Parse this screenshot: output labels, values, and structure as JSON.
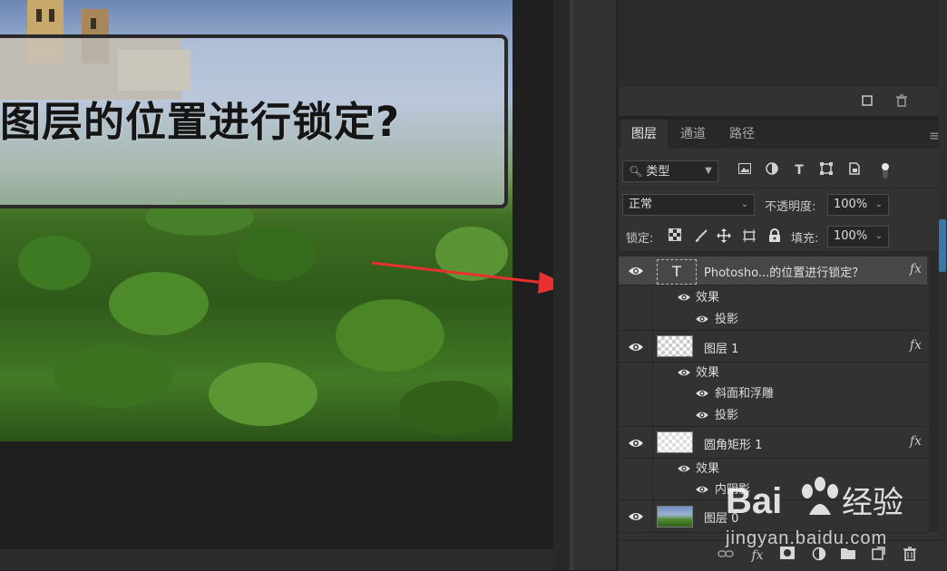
{
  "canvas": {
    "title_text": "图层的位置进行锁定?"
  },
  "panel_tabs": [
    {
      "label": "图层"
    },
    {
      "label": "通道"
    },
    {
      "label": "路径"
    }
  ],
  "filter": {
    "kind_label": "类型",
    "icons": [
      "image-filter-icon",
      "adjustment-filter-icon",
      "type-filter-icon",
      "shape-filter-icon",
      "smart-object-filter-icon",
      "filter-toggle-icon"
    ]
  },
  "blend": {
    "mode": "正常",
    "opacity_label": "不透明度:",
    "opacity_value": "100%"
  },
  "lock": {
    "label": "锁定:",
    "fill_label": "填充:",
    "fill_value": "100%"
  },
  "layers": [
    {
      "name": "Photosho...的位置进行锁定？",
      "type": "text",
      "fx": "fx",
      "effects_label": "效果",
      "effects": [
        "投影"
      ]
    },
    {
      "name": "图层 1",
      "type": "pixel",
      "fx": "fx",
      "effects_label": "效果",
      "effects": [
        "斜面和浮雕",
        "投影"
      ]
    },
    {
      "name": "圆角矩形 1",
      "type": "shape",
      "fx": "fx",
      "effects_label": "效果",
      "effects": [
        "内阴影"
      ]
    },
    {
      "name": "图层 0",
      "type": "image"
    }
  ],
  "thumb_text_glyph": "T",
  "watermark": {
    "logo_text": "Baidu经验",
    "url": "jingyan.baidu.com"
  },
  "colors": {
    "arrow": "#e8312f",
    "selection": "#474747",
    "panel": "#323232"
  }
}
